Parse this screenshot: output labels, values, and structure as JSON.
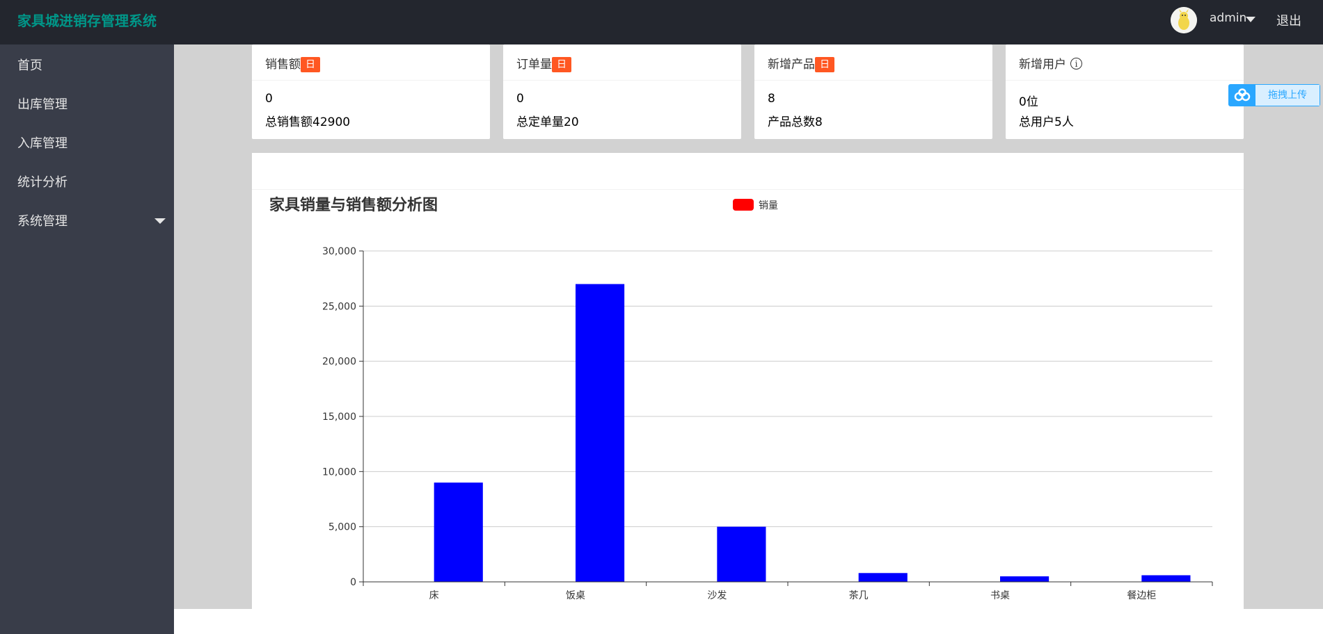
{
  "app": {
    "title": "家具城进销存管理系统"
  },
  "header": {
    "user": "admin",
    "logout": "退出"
  },
  "sidebar": {
    "items": [
      {
        "label": "首页"
      },
      {
        "label": "出库管理"
      },
      {
        "label": "入库管理"
      },
      {
        "label": "统计分析"
      },
      {
        "label": "系统管理",
        "has_submenu": true
      }
    ]
  },
  "cards": [
    {
      "title": "销售额",
      "badge": "日",
      "value": "0",
      "total": "总销售额42900"
    },
    {
      "title": "订单量",
      "badge": "日",
      "value": "0",
      "total": "总定单量20"
    },
    {
      "title": "新增产品",
      "badge": "日",
      "value": "8",
      "total": "产品总数8"
    },
    {
      "title": "新增用户",
      "badge": "",
      "value": "0位",
      "total": "总用户5人",
      "info_icon": "info-icon"
    }
  ],
  "upload": {
    "label": "拖拽上传",
    "icon": "cloud-icon"
  },
  "colors": {
    "accent": "#009688",
    "badge": "#ff5722",
    "bar": "#0000ff",
    "legend": "#ff0000"
  },
  "chart_data": {
    "type": "bar",
    "title": "家具销量与销售额分析图",
    "categories": [
      "床",
      "饭桌",
      "沙发",
      "茶几",
      "书桌",
      "餐边柜"
    ],
    "series": [
      {
        "name": "销量",
        "values": [
          0,
          0,
          0,
          0,
          0,
          0
        ],
        "color": "#ff0000"
      },
      {
        "name": "",
        "values": [
          9000,
          27000,
          5000,
          800,
          500,
          600
        ],
        "color": "#0000ff"
      }
    ],
    "ylim": [
      0,
      30000
    ],
    "yticks": [
      "0",
      "5,000",
      "10,000",
      "15,000",
      "20,000",
      "25,000",
      "30,000"
    ],
    "grid": true,
    "legend": "top-center"
  }
}
